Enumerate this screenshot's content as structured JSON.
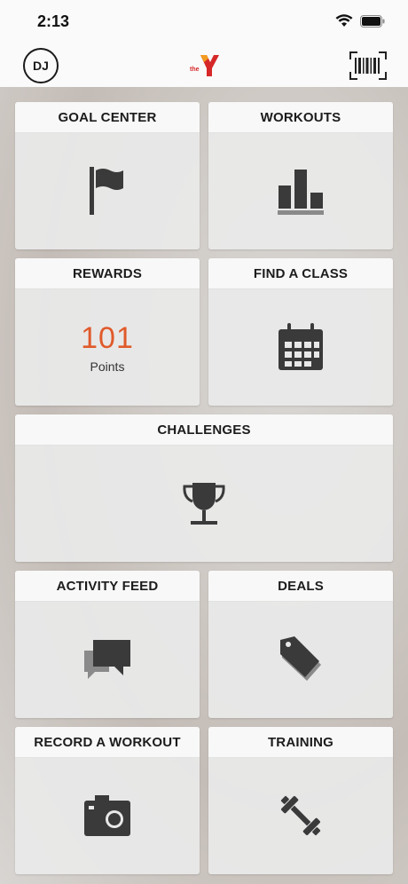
{
  "status": {
    "time": "2:13"
  },
  "header": {
    "avatar_initials": "DJ",
    "logo_text": "the"
  },
  "tiles": {
    "goal_center": "GOAL CENTER",
    "workouts": "WORKOUTS",
    "rewards": "REWARDS",
    "find_a_class": "FIND A CLASS",
    "challenges": "CHALLENGES",
    "activity_feed": "ACTIVITY FEED",
    "deals": "DEALS",
    "record_a_workout": "RECORD A WORKOUT",
    "training": "TRAINING"
  },
  "rewards": {
    "points_value": "101",
    "points_label": "Points"
  },
  "colors": {
    "accent": "#e05a2b",
    "icon": "#3a3a3a",
    "logo_red": "#d62828"
  },
  "icons": [
    "flag-icon",
    "bar-chart-icon",
    "calendar-icon",
    "trophy-icon",
    "chat-bubbles-icon",
    "tag-icon",
    "camera-icon",
    "dumbbell-icon",
    "barcode-icon",
    "wifi-icon",
    "battery-icon"
  ]
}
